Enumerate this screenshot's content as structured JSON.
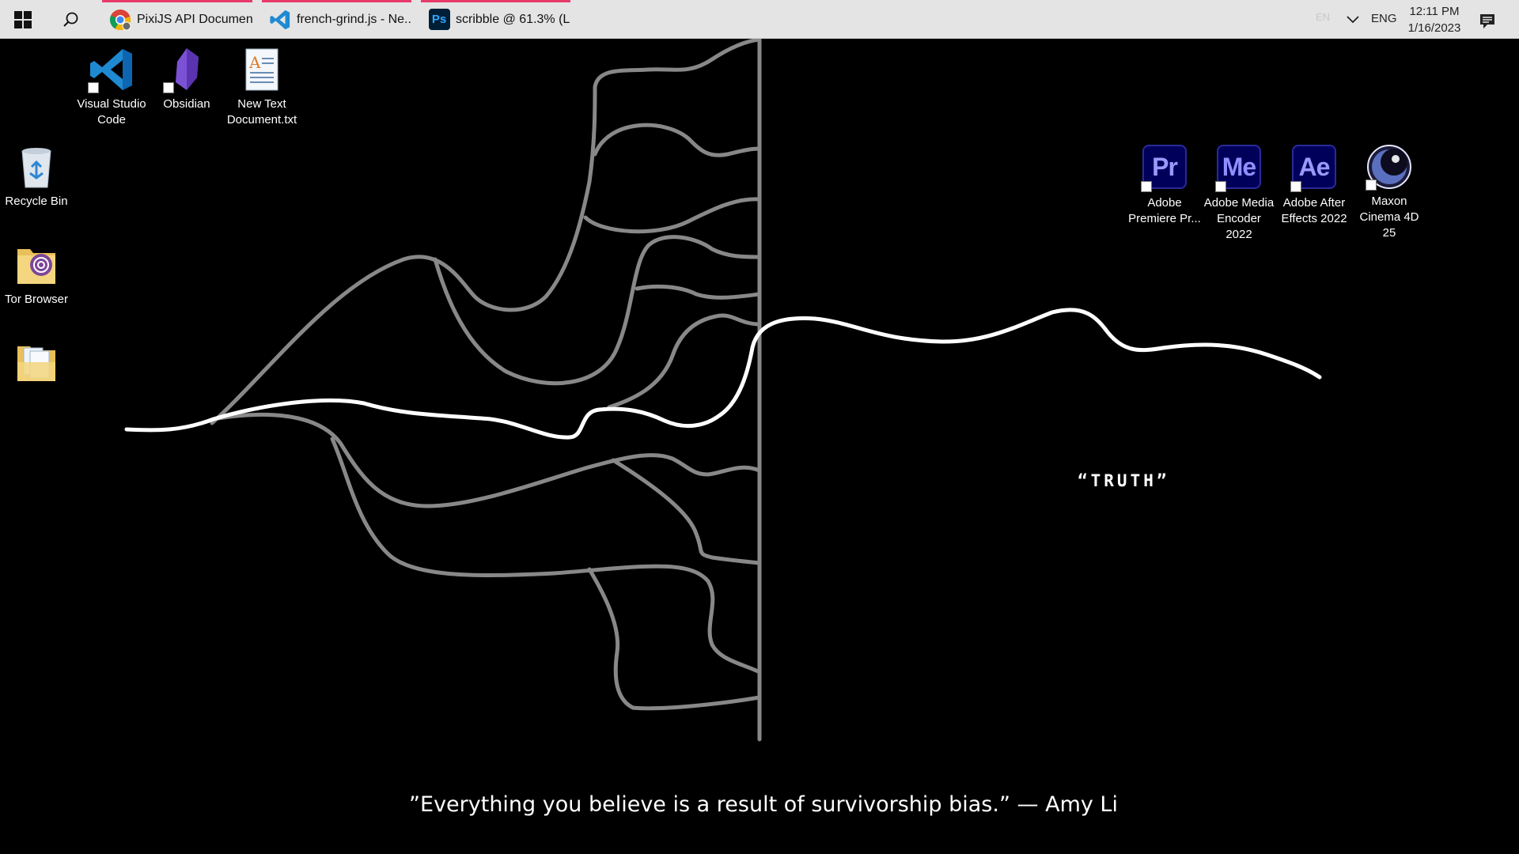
{
  "taskbar": {
    "apps": [
      {
        "label": "PixiJS API Documen...",
        "icon": "chrome-icon"
      },
      {
        "label": "french-grind.js - Ne...",
        "icon": "vscode-icon"
      },
      {
        "label": "scribble @ 61.3% (L...",
        "icon": "photoshop-icon"
      }
    ],
    "indicator_color": "#e83a6b",
    "tray": {
      "ime": "EN",
      "language": "ENG",
      "time": "12:11 PM",
      "date": "1/16/2023"
    }
  },
  "desktop": {
    "icons": [
      {
        "label": "Visual Studio Code",
        "icon": "vscode-icon"
      },
      {
        "label": "Obsidian",
        "icon": "obsidian-icon"
      },
      {
        "label": "New Text Document.txt",
        "icon": "text-document-icon"
      },
      {
        "label": "Recycle Bin",
        "icon": "recycle-bin-icon"
      },
      {
        "label": "Tor Browser",
        "icon": "tor-browser-icon"
      },
      {
        "label": "",
        "icon": "folder-icon"
      },
      {
        "label": "Adobe Premiere Pr...",
        "icon": "premiere-pro-icon",
        "abbr": "Pr",
        "color": "#9999ff",
        "bg": "#00005b"
      },
      {
        "label": "Adobe Media Encoder 2022",
        "icon": "media-encoder-icon",
        "abbr": "Me",
        "color": "#8f8fff",
        "bg": "#00005b"
      },
      {
        "label": "Adobe After Effects 2022",
        "icon": "after-effects-icon",
        "abbr": "Ae",
        "color": "#9999ff",
        "bg": "#00005b"
      },
      {
        "label": "Maxon Cinema 4D 25",
        "icon": "cinema4d-icon"
      }
    ]
  },
  "wallpaper": {
    "label": "“TRUTH”",
    "quote": "”Everything you believe is a result of survivorship bias.” — Amy Li",
    "line_color": "#888888",
    "truth_line_color": "#ffffff"
  }
}
